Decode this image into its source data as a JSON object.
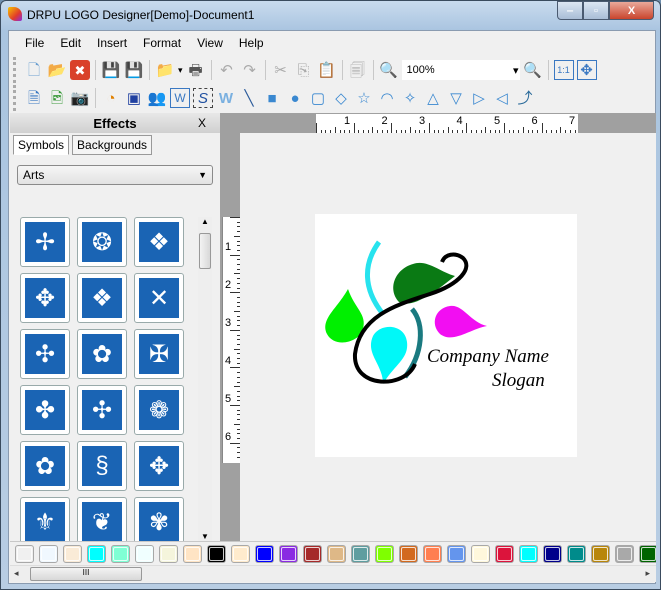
{
  "window": {
    "title": "DRPU LOGO Designer[Demo]-Document1",
    "min": "‒",
    "max": "▫",
    "close": "X"
  },
  "menu": [
    "File",
    "Edit",
    "Insert",
    "Format",
    "View",
    "Help"
  ],
  "toolbar": {
    "zoom_value": "100%",
    "zoom_arrow": "▾",
    "fit_label": "1:1"
  },
  "panel": {
    "title": "Effects",
    "close": "X",
    "tabs": [
      "Symbols",
      "Backgrounds"
    ],
    "category": "Arts",
    "dropdown_arrow": "▼"
  },
  "symbols": [
    "✢",
    "❂",
    "❖",
    "✥",
    "❖",
    "✕",
    "✣",
    "✿",
    "✠",
    "✤",
    "✣",
    "❁",
    "✿",
    "§",
    "✥",
    "⚜",
    "❦",
    "✾"
  ],
  "ruler": {
    "h": [
      "1",
      "2",
      "3",
      "4",
      "5",
      "6",
      "7"
    ],
    "v": [
      "1",
      "2",
      "3",
      "4",
      "5",
      "6"
    ]
  },
  "logo": {
    "company": "Company Name",
    "slogan": "Slogan"
  },
  "palette": [
    "#f0f0f0",
    "#f0f8ff",
    "#faebd7",
    "#00ffff",
    "#7fffd4",
    "#f0ffff",
    "#f5f5dc",
    "#ffe4c4",
    "#000000",
    "#ffebcd",
    "#0000ff",
    "#8a2be2",
    "#a52a2a",
    "#deb887",
    "#5f9ea0",
    "#7fff00",
    "#d2691e",
    "#ff7f50",
    "#6495ed",
    "#fff8dc",
    "#dc143c",
    "#00ffff",
    "#00008b",
    "#008b8b",
    "#b8860b",
    "#a9a9a9",
    "#006400"
  ],
  "scroll": {
    "grip": "III",
    "left": "◂",
    "right": "▸"
  }
}
